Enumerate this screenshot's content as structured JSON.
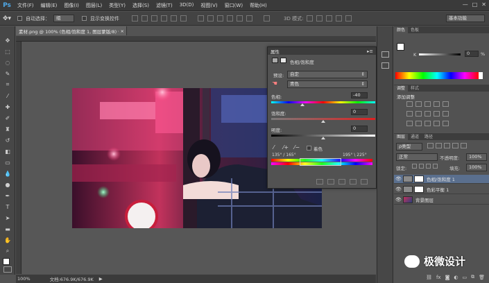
{
  "app": {
    "logo": "Ps",
    "menus": [
      "文件(F)",
      "编辑(E)",
      "图像(I)",
      "图层(L)",
      "类型(Y)",
      "选择(S)",
      "滤镜(T)",
      "3D(D)",
      "视图(V)",
      "窗口(W)",
      "帮助(H)"
    ],
    "window_controls": [
      "—",
      "□",
      "✕"
    ]
  },
  "options_bar": {
    "auto_select_label": "自动选择：",
    "auto_select_value": "组",
    "show_transform_label": "显示变换控件",
    "workspace": "基本功能"
  },
  "document": {
    "tab_title": "素材.png @ 100% (色相/饱和度 1, 图层蒙版/8) *",
    "tab_close": "×",
    "zoom": "100%",
    "doc_info": "文档:676.9K/676.9K"
  },
  "properties": {
    "panel_title": "属性",
    "adjustment_name": "色相/饱和度",
    "preset_label": "预设:",
    "preset_value": "自定",
    "channel_value": "青色",
    "hue_label": "色相:",
    "hue_value": "-40",
    "saturation_label": "饱和度:",
    "saturation_value": "0",
    "lightness_label": "明度:",
    "lightness_value": "0",
    "colorize_label": "着色",
    "range_left": "135° / 165°",
    "range_right": "195° \\ 225°",
    "hue_level": 0.3,
    "saturation_level": 0.5,
    "lightness_level": 0.5
  },
  "color_panel": {
    "tabs": [
      "颜色",
      "色板"
    ],
    "slider_label": "K",
    "slider_value": "0",
    "unit": "%",
    "foreground": "#000000",
    "background": "#ffffff"
  },
  "adjustments_panel": {
    "tabs": [
      "调整",
      "样式"
    ],
    "heading": "添加调整"
  },
  "layers_panel": {
    "tabs": [
      "图层",
      "通道",
      "路径"
    ],
    "filter_label": "ρ类型",
    "blend_mode": "正常",
    "opacity_label": "不透明度:",
    "opacity_value": "100%",
    "lock_label": "锁定:",
    "fill_label": "填充:",
    "fill_value": "100%",
    "layers": [
      {
        "name": "色相/饱和度 1",
        "selected": true,
        "thumb": "adjust"
      },
      {
        "name": "色彩平衡 1",
        "selected": false,
        "thumb": "adjust"
      },
      {
        "name": "背景图层",
        "selected": false,
        "thumb": "photo"
      }
    ],
    "footer_icons": [
      "link-icon",
      "fx-icon",
      "mask-icon",
      "adjustment-icon",
      "folder-icon",
      "new-layer-icon",
      "trash-icon"
    ]
  },
  "watermark": {
    "text": "极微设计"
  },
  "colors": {
    "menubar": "#3a3a3a",
    "panel": "#525252",
    "selection": "#5a6f8e",
    "ps_blue": "#4fa9e8"
  }
}
